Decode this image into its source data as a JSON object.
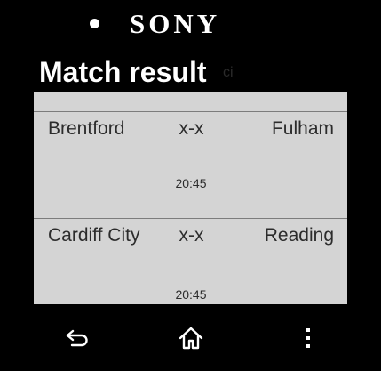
{
  "device": {
    "brand": "SONY"
  },
  "app": {
    "title": "Match result",
    "title_ghost": "ci"
  },
  "matches": [
    {
      "home": "Brentford",
      "score": "x-x",
      "away": "Fulham",
      "time": "20:45"
    },
    {
      "home": "Cardiff City",
      "score": "x-x",
      "away": "Reading",
      "time": "20:45"
    }
  ],
  "nav": {
    "back_icon": "back-arrow-icon",
    "home_icon": "home-icon",
    "menu_icon": "overflow-menu-icon"
  },
  "colors": {
    "screen_background": "#d4d4d4",
    "title_bar": "#000000",
    "text": "#2c2c2c"
  }
}
